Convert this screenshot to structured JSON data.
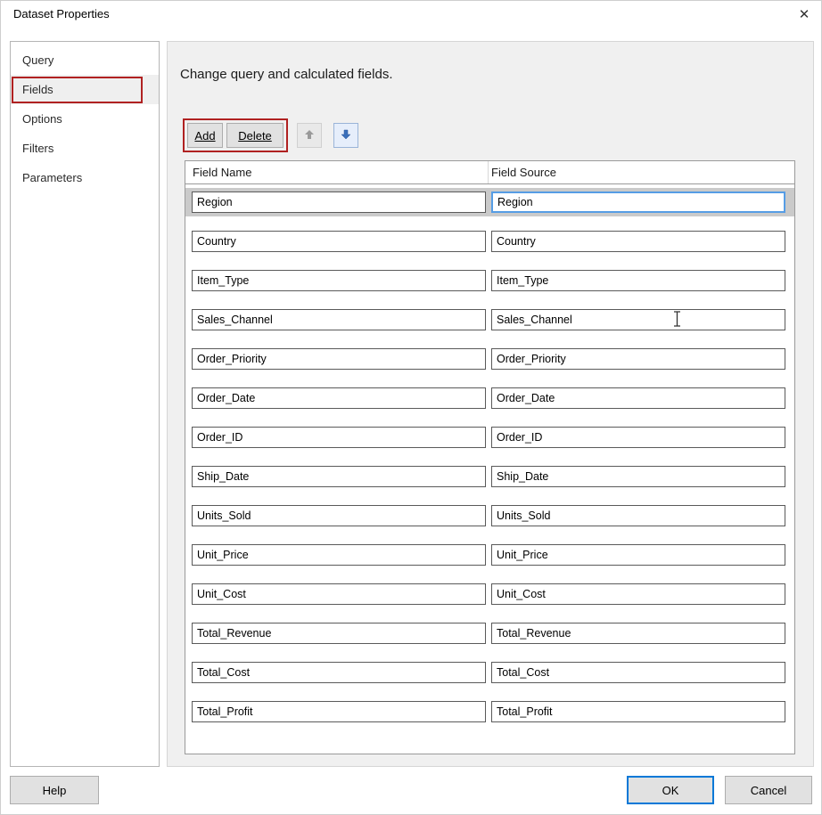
{
  "window": {
    "title": "Dataset Properties",
    "close_icon": "✕"
  },
  "sidebar": {
    "items": [
      {
        "label": "Query",
        "selected": false,
        "annotated": false
      },
      {
        "label": "Fields",
        "selected": true,
        "annotated": true
      },
      {
        "label": "Options",
        "selected": false,
        "annotated": false
      },
      {
        "label": "Filters",
        "selected": false,
        "annotated": false
      },
      {
        "label": "Parameters",
        "selected": false,
        "annotated": false
      }
    ]
  },
  "main": {
    "heading": "Change query and calculated fields.",
    "toolbar": {
      "add_label": "Add",
      "delete_label": "Delete",
      "up_icon": "up-arrow",
      "down_icon": "down-arrow"
    },
    "table": {
      "columns": [
        "Field Name",
        "Field Source"
      ],
      "rows": [
        {
          "name": "Region",
          "source": "Region",
          "selected": true
        },
        {
          "name": "Country",
          "source": "Country",
          "selected": false
        },
        {
          "name": "Item_Type",
          "source": "Item_Type",
          "selected": false
        },
        {
          "name": "Sales_Channel",
          "source": "Sales_Channel",
          "selected": false
        },
        {
          "name": "Order_Priority",
          "source": "Order_Priority",
          "selected": false
        },
        {
          "name": "Order_Date",
          "source": "Order_Date",
          "selected": false
        },
        {
          "name": "Order_ID",
          "source": "Order_ID",
          "selected": false
        },
        {
          "name": "Ship_Date",
          "source": "Ship_Date",
          "selected": false
        },
        {
          "name": "Units_Sold",
          "source": "Units_Sold",
          "selected": false
        },
        {
          "name": "Unit_Price",
          "source": "Unit_Price",
          "selected": false
        },
        {
          "name": "Unit_Cost",
          "source": "Unit_Cost",
          "selected": false
        },
        {
          "name": "Total_Revenue",
          "source": "Total_Revenue",
          "selected": false
        },
        {
          "name": "Total_Cost",
          "source": "Total_Cost",
          "selected": false
        },
        {
          "name": "Total_Profit",
          "source": "Total_Profit",
          "selected": false
        }
      ]
    }
  },
  "footer": {
    "help_label": "Help",
    "ok_label": "OK",
    "cancel_label": "Cancel"
  },
  "colors": {
    "accent": "#0078d7",
    "annotation_red": "#b02121",
    "selected_row": "#cacaca",
    "down_arrow_blue": "#3a6fba",
    "disabled_arrow_gray": "#9a9a9a"
  }
}
